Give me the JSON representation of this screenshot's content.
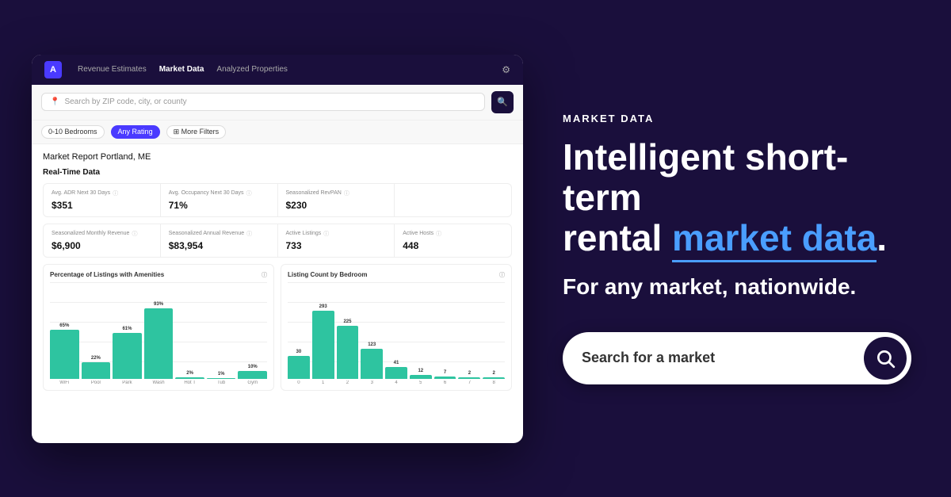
{
  "page": {
    "background_color": "#1a0f3c"
  },
  "nav": {
    "logo_text": "A",
    "links": [
      {
        "label": "Revenue Estimates",
        "active": false
      },
      {
        "label": "Market Data",
        "active": true
      },
      {
        "label": "Analyzed Properties",
        "active": false
      }
    ],
    "gear_icon": "⚙"
  },
  "search": {
    "placeholder": "Search by ZIP code, city, or county",
    "search_icon": "🔍",
    "button_icon": "🔍"
  },
  "filters": [
    {
      "label": "0-10 Bedrooms",
      "active": false
    },
    {
      "label": "Any Rating",
      "active": true
    },
    {
      "label": "⊞ More Filters",
      "active": false
    }
  ],
  "market_report": {
    "title": "Market Report",
    "location": " Portland, ME"
  },
  "realtime_section": {
    "title": "Real-Time Data"
  },
  "stats": [
    {
      "label": "Avg. ADR Next 30 Days",
      "value": "$351"
    },
    {
      "label": "Avg. Occupancy Next 30 Days",
      "value": "71%"
    },
    {
      "label": "Seasonalized RevPAN",
      "value": "$230"
    },
    {
      "label": "",
      "value": ""
    },
    {
      "label": "Seasonalized Monthly Revenue",
      "value": "$6,900"
    },
    {
      "label": "Seasonalized Annual Revenue",
      "value": "$83,954"
    },
    {
      "label": "Active Listings",
      "value": "733"
    },
    {
      "label": "Active Hosts",
      "value": "448"
    }
  ],
  "chart1": {
    "title": "Percentage of Listings with Amenities",
    "bars": [
      {
        "height_pct": 65,
        "label": "65%",
        "category": "WiFi"
      },
      {
        "height_pct": 22,
        "label": "22%",
        "category": "Pool"
      },
      {
        "height_pct": 61,
        "label": "61%",
        "category": "Park"
      },
      {
        "height_pct": 93,
        "label": "93%",
        "category": "Wash"
      },
      {
        "height_pct": 2,
        "label": "2%",
        "category": "Hot T"
      },
      {
        "height_pct": 1,
        "label": "1%",
        "category": "Tub"
      },
      {
        "height_pct": 10,
        "label": "10%",
        "category": "Gym"
      }
    ]
  },
  "chart2": {
    "title": "Listing Count by Bedroom",
    "bars": [
      {
        "height_pct": 30,
        "label": "30",
        "category": "0"
      },
      {
        "height_pct": 90,
        "label": "293",
        "category": "1"
      },
      {
        "height_pct": 70,
        "label": "225",
        "category": "2"
      },
      {
        "height_pct": 40,
        "label": "123",
        "category": "3"
      },
      {
        "height_pct": 15,
        "label": "41",
        "category": "4"
      },
      {
        "height_pct": 5,
        "label": "12",
        "category": "5"
      },
      {
        "height_pct": 3,
        "label": "7",
        "category": "6"
      },
      {
        "height_pct": 2,
        "label": "2",
        "category": "7"
      },
      {
        "height_pct": 2,
        "label": "2",
        "category": "8"
      }
    ]
  },
  "right_panel": {
    "market_data_label": "MARKET DATA",
    "headline_part1": "Intelligent short-term",
    "headline_part2_normal": "rental ",
    "headline_part2_highlight": "market data",
    "headline_part2_end": ".",
    "sub_headline": "For any market, nationwide.",
    "search_placeholder": "Search for a market",
    "search_icon": "🔍"
  }
}
